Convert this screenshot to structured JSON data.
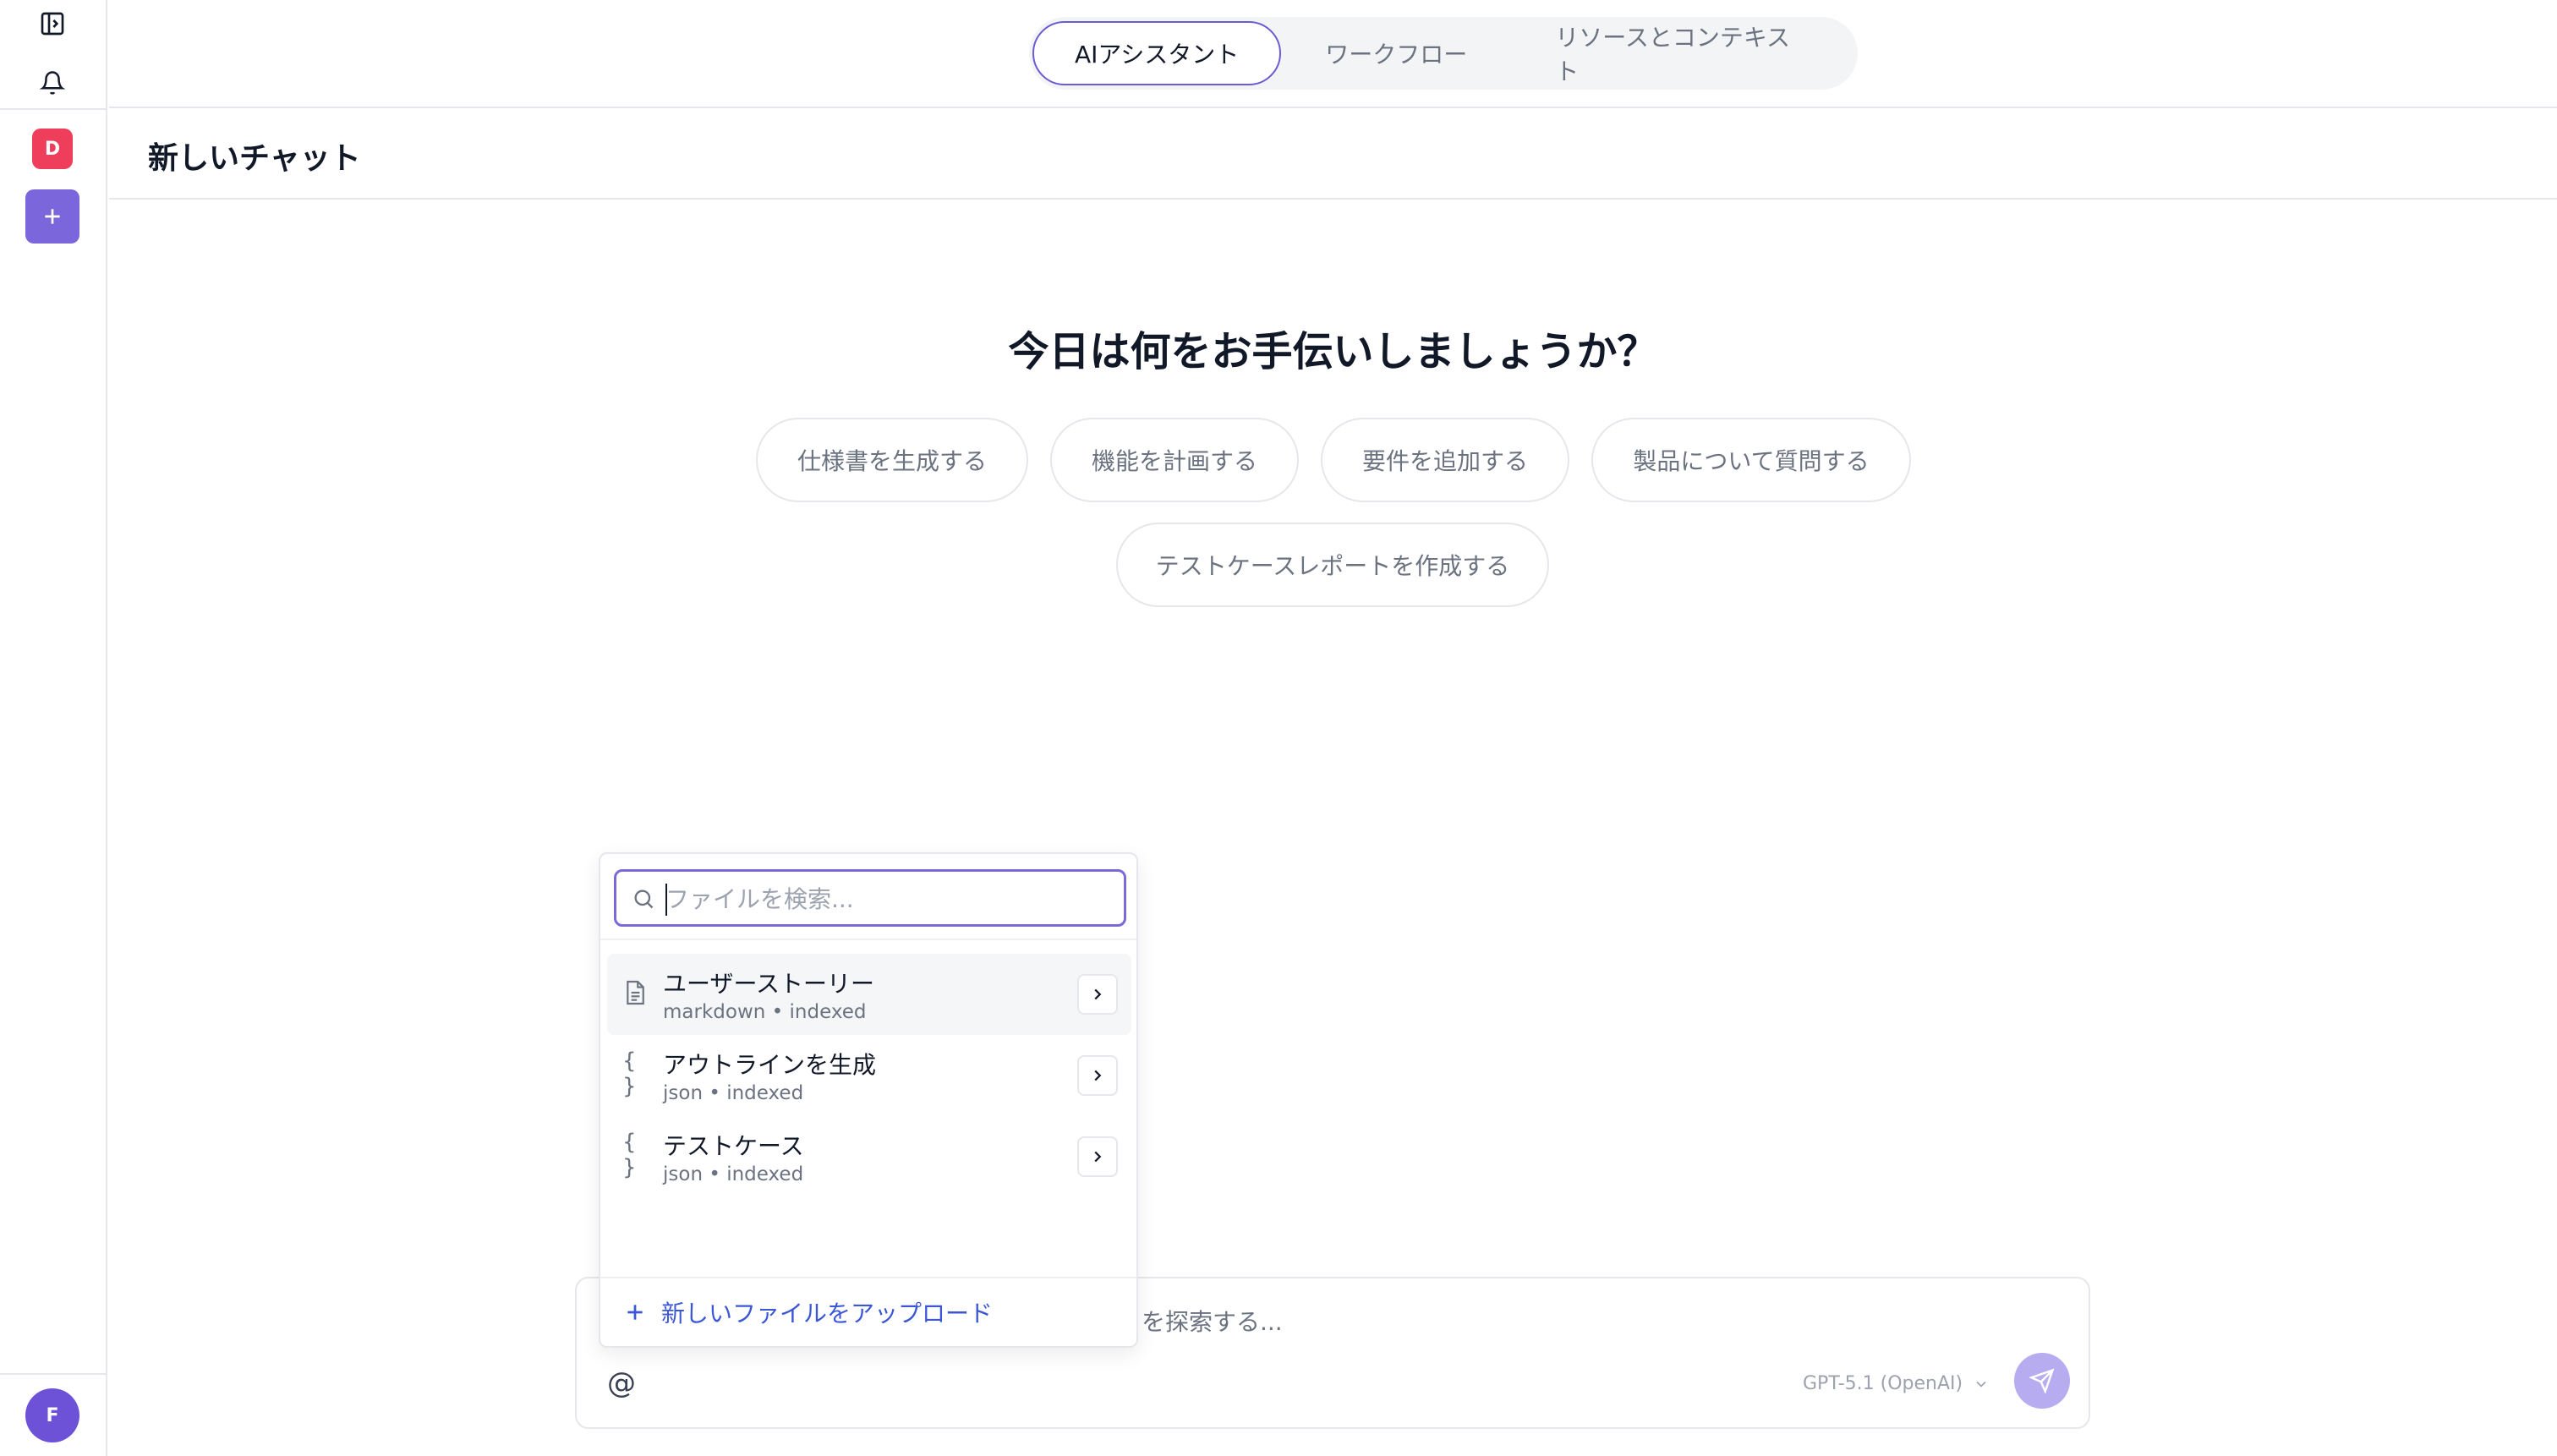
{
  "rail": {
    "workspace_badge": "D",
    "user_avatar": "F",
    "icons": [
      "sidebar-toggle-icon",
      "bell-icon",
      "plus-icon"
    ]
  },
  "tabs": [
    {
      "label": "AIアシスタント",
      "active": true
    },
    {
      "label": "ワークフロー",
      "active": false
    },
    {
      "label": "リソースとコンテキスト",
      "active": false
    }
  ],
  "chat": {
    "title": "新しいチャット",
    "greeting": "今日は何をお手伝いしましょうか？"
  },
  "suggestions": [
    "仕様書を生成する",
    "機能を計画する",
    "要件を追加する",
    "製品について質問する",
    "テストケースレポートを作成する"
  ],
  "file_picker": {
    "search_placeholder": "ファイルを検索...",
    "files": [
      {
        "name": "ユーザーストーリー",
        "meta": "markdown • indexed",
        "icon": "document-icon"
      },
      {
        "name": "アウトラインを生成",
        "meta": "json • indexed",
        "icon": "braces-icon"
      },
      {
        "name": "テストケース",
        "meta": "json • indexed",
        "icon": "braces-icon"
      }
    ],
    "upload_label": "新しいファイルをアップロード"
  },
  "composer": {
    "placeholder_visible": "を探索する...",
    "mention_symbol": "@",
    "model": "GPT-5.1 (OpenAI)"
  },
  "colors": {
    "accent": "#6b5bd2",
    "badge_red": "#ef3e5c",
    "link_blue": "#3b57d6",
    "send_disabled": "#b7acf0"
  }
}
